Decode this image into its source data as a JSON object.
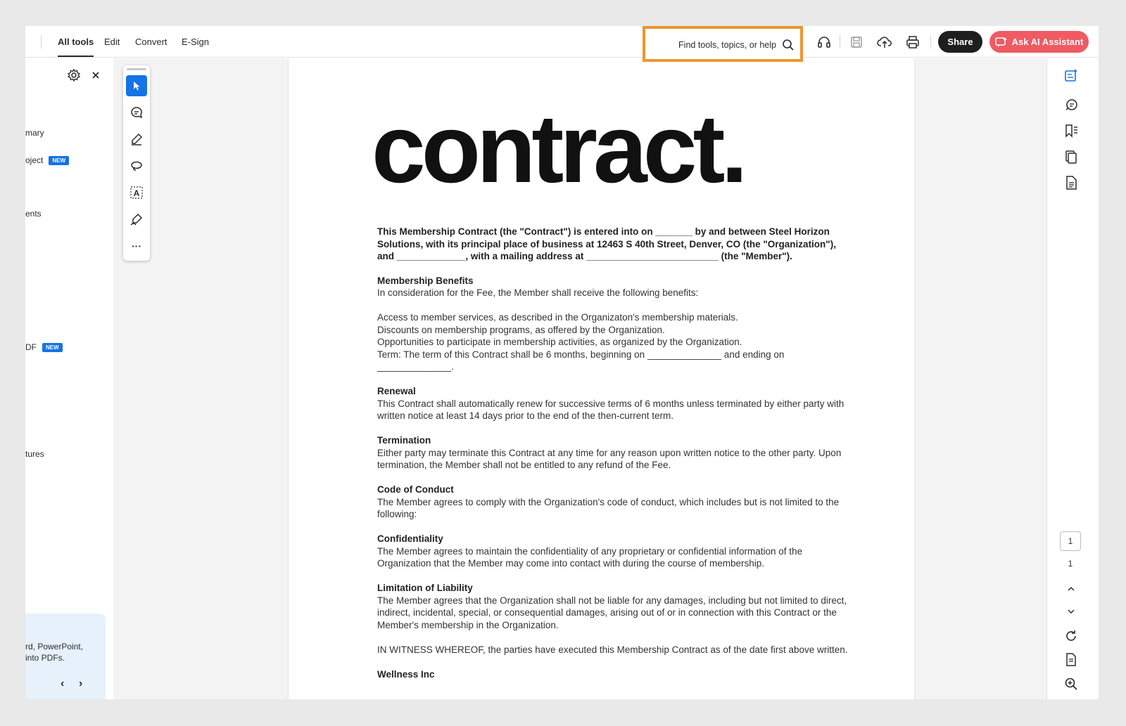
{
  "toolbar": {
    "tabs": [
      {
        "label": "All tools",
        "active": true
      },
      {
        "label": "Edit",
        "active": false
      },
      {
        "label": "Convert",
        "active": false
      },
      {
        "label": "E-Sign",
        "active": false
      }
    ],
    "search_placeholder": "Find tools, topics, or help",
    "share_label": "Share",
    "ai_assistant_label": "Ask AI Assistant",
    "icons": [
      "headphones-icon",
      "save-icon",
      "upload-cloud-icon",
      "print-icon"
    ]
  },
  "left_panel": {
    "items": [
      {
        "label": "mary",
        "badge": ""
      },
      {
        "label": "oject",
        "badge": "NEW"
      },
      {
        "label": "ents",
        "badge": ""
      },
      {
        "label": "DF",
        "badge": "NEW"
      },
      {
        "label": "tures",
        "badge": ""
      }
    ],
    "promo_lines": [
      "rd, PowerPoint,",
      "into PDFs."
    ],
    "prev_label": "‹",
    "next_label": "›"
  },
  "tool_rail": {
    "tools": [
      "select-tool",
      "comment-tool",
      "highlight-tool",
      "lasso-tool",
      "text-recognition-tool",
      "draw-tool",
      "more-tools"
    ],
    "more_label": "···"
  },
  "document": {
    "title": "contract.",
    "intro": "This Membership Contract (the \"Contract\") is entered into on _______ by and between Steel Horizon Solutions, with its principal place of business at 12463 S 40th Street, Denver, CO (the \"Organization\"), and _____________, with a mailing address at _________________________ (the \"Member\").",
    "sections": [
      {
        "heading": "Membership Benefits",
        "lines": [
          "In consideration for the Fee, the Member shall receive the following benefits:",
          "",
          "Access to member services, as described in the Organizaton's membership materials.",
          "Discounts on membership programs, as offered by the Organization.",
          "Opportunities to participate in membership activities, as organized by the Organization.",
          "Term: The term of this Contract shall be 6 months, beginning on ______________ and ending on ______________."
        ]
      },
      {
        "heading": "Renewal",
        "lines": [
          "This Contract shall automatically renew for successive terms of 6 months unless terminated by either party with written notice at least 14 days prior to the end of the then-current term."
        ]
      },
      {
        "heading": "Termination",
        "lines": [
          "Either party may terminate this Contract at any time for any reason upon written notice to the other party. Upon termination, the Member shall not be entitled to any refund of the Fee."
        ]
      },
      {
        "heading": "Code of Conduct",
        "lines": [
          "The Member agrees to comply with the Organization's code of conduct, which includes but is not limited to the following:"
        ]
      },
      {
        "heading": "Confidentiality",
        "lines": [
          "The Member agrees to maintain the confidentiality of any proprietary or confidential information of the Organization that the Member may come into contact with during the course of membership."
        ]
      },
      {
        "heading": "Limitation of Liability",
        "lines": [
          "The Member agrees that the Organization shall not be liable for any damages, including but not limited to direct, indirect, incidental, special, or consequential damages, arising out of or in connection with this Contract or the Member's membership in the Organization.",
          "",
          "IN WITNESS WHEREOF, the parties have executed this Membership Contract as of the date first above written."
        ]
      },
      {
        "heading": "Wellness Inc",
        "lines": []
      }
    ]
  },
  "page_nav": {
    "current_page": "1",
    "total_pages": "1"
  },
  "colors": {
    "accent_blue": "#1473e6",
    "search_highlight": "#f0962e",
    "ai_button": "#ef5a63",
    "share_button": "#1e1e1e"
  }
}
